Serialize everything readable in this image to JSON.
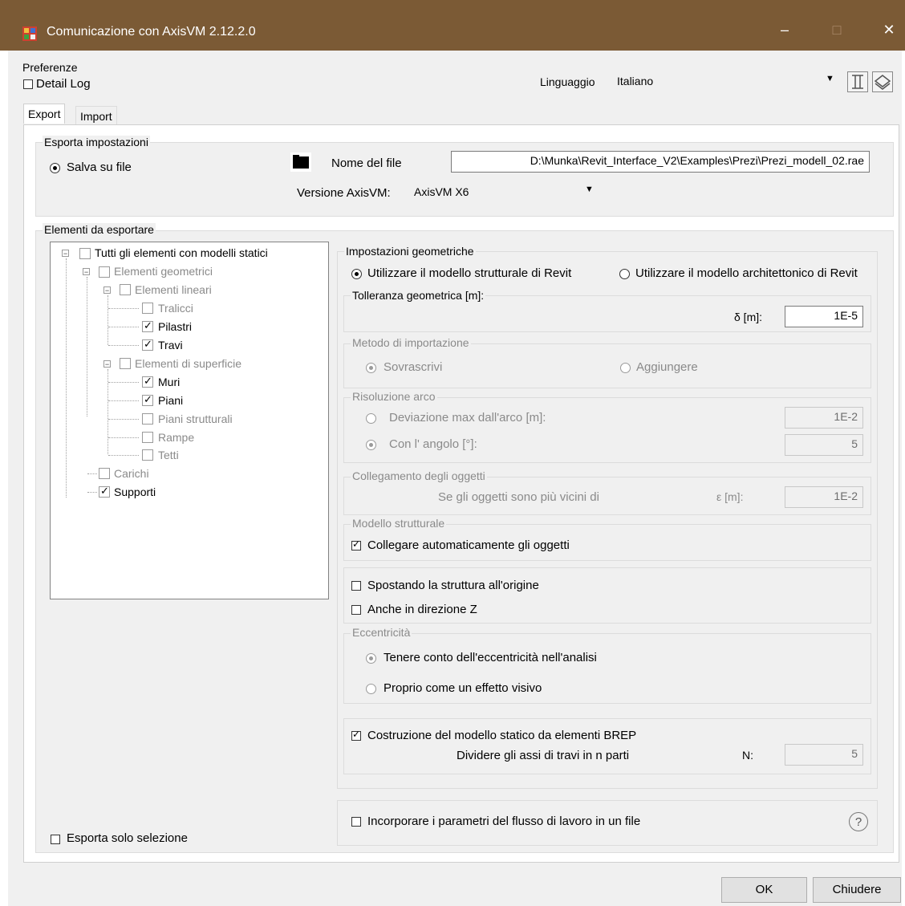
{
  "window": {
    "title": "Comunicazione con AxisVM 2.12.2.0",
    "minimize": "–",
    "maximize": "□",
    "close": "✕"
  },
  "prefs": {
    "group_label": "Preferenze",
    "detail_log": "Detail Log",
    "language_label": "Linguaggio",
    "language_value": "Italiano"
  },
  "tabs": {
    "export": "Export",
    "import": "Import"
  },
  "export_settings": {
    "group_label": "Esporta impostazioni",
    "save_to_file": "Salva su file",
    "file_name_label": "Nome del file",
    "file_path": "D:\\Munka\\Revit_Interface_V2\\Examples\\Prezi\\Prezi_modell_02.rae",
    "version_label": "Versione AxisVM:",
    "version_value": "AxisVM X6"
  },
  "elements": {
    "group_label": "Elementi da esportare",
    "tree": {
      "all": "Tutti gli elementi con modelli statici",
      "geom": "Elementi geometrici",
      "linear": "Elementi lineari",
      "tralicci": "Tralicci",
      "pilastri": "Pilastri",
      "travi": "Travi",
      "surface": "Elementi di superficie",
      "muri": "Muri",
      "piani": "Piani",
      "piani_strutturali": "Piani strutturali",
      "rampe": "Rampe",
      "tetti": "Tetti",
      "carichi": "Carichi",
      "supporti": "Supporti"
    },
    "export_selection": "Esporta solo selezione"
  },
  "geom": {
    "group_label": "Impostazioni geometriche",
    "use_structural": "Utilizzare il modello strutturale di Revit",
    "use_architectural": "Utilizzare il modello architettonico di Revit",
    "tolerance_label": "Tolleranza geometrica [m]:",
    "delta_label": "δ [m]:",
    "delta_value": "1E-5"
  },
  "import_method": {
    "label": "Metodo di importazione",
    "overwrite": "Sovrascrivi",
    "add": "Aggiungere"
  },
  "arc": {
    "label": "Risoluzione arco",
    "max_dev": "Deviazione max dall'arco [m]:",
    "max_dev_value": "1E-2",
    "angle": "Con l' angolo [°]:",
    "angle_value": "5"
  },
  "connect": {
    "label": "Collegamento degli oggetti",
    "text": "Se gli oggetti sono più vicini di",
    "eps_label": "ε [m]:",
    "eps_value": "1E-2"
  },
  "structural": {
    "label": "Modello strutturale",
    "auto_connect": "Collegare automaticamente gli oggetti"
  },
  "move": {
    "to_origin": "Spostando la struttura all'origine",
    "z_dir": "Anche in direzione Z"
  },
  "ecc": {
    "label": "Eccentricità",
    "analysis": "Tenere conto dell'eccentricità nell'analisi",
    "visual": "Proprio come un effetto visivo"
  },
  "brep": {
    "build": "Costruzione del modello statico da elementi BREP",
    "divide": "Dividere gli assi di travi in n parti",
    "n_label": "N:",
    "n_value": "5"
  },
  "workflow": {
    "embed": "Incorporare i parametri del flusso di lavoro in un file",
    "help": "?"
  },
  "buttons": {
    "ok": "OK",
    "close": "Chiudere"
  },
  "colors": {
    "titlebar": "#7b5a35",
    "dialog_bg": "#f0f0f0"
  }
}
